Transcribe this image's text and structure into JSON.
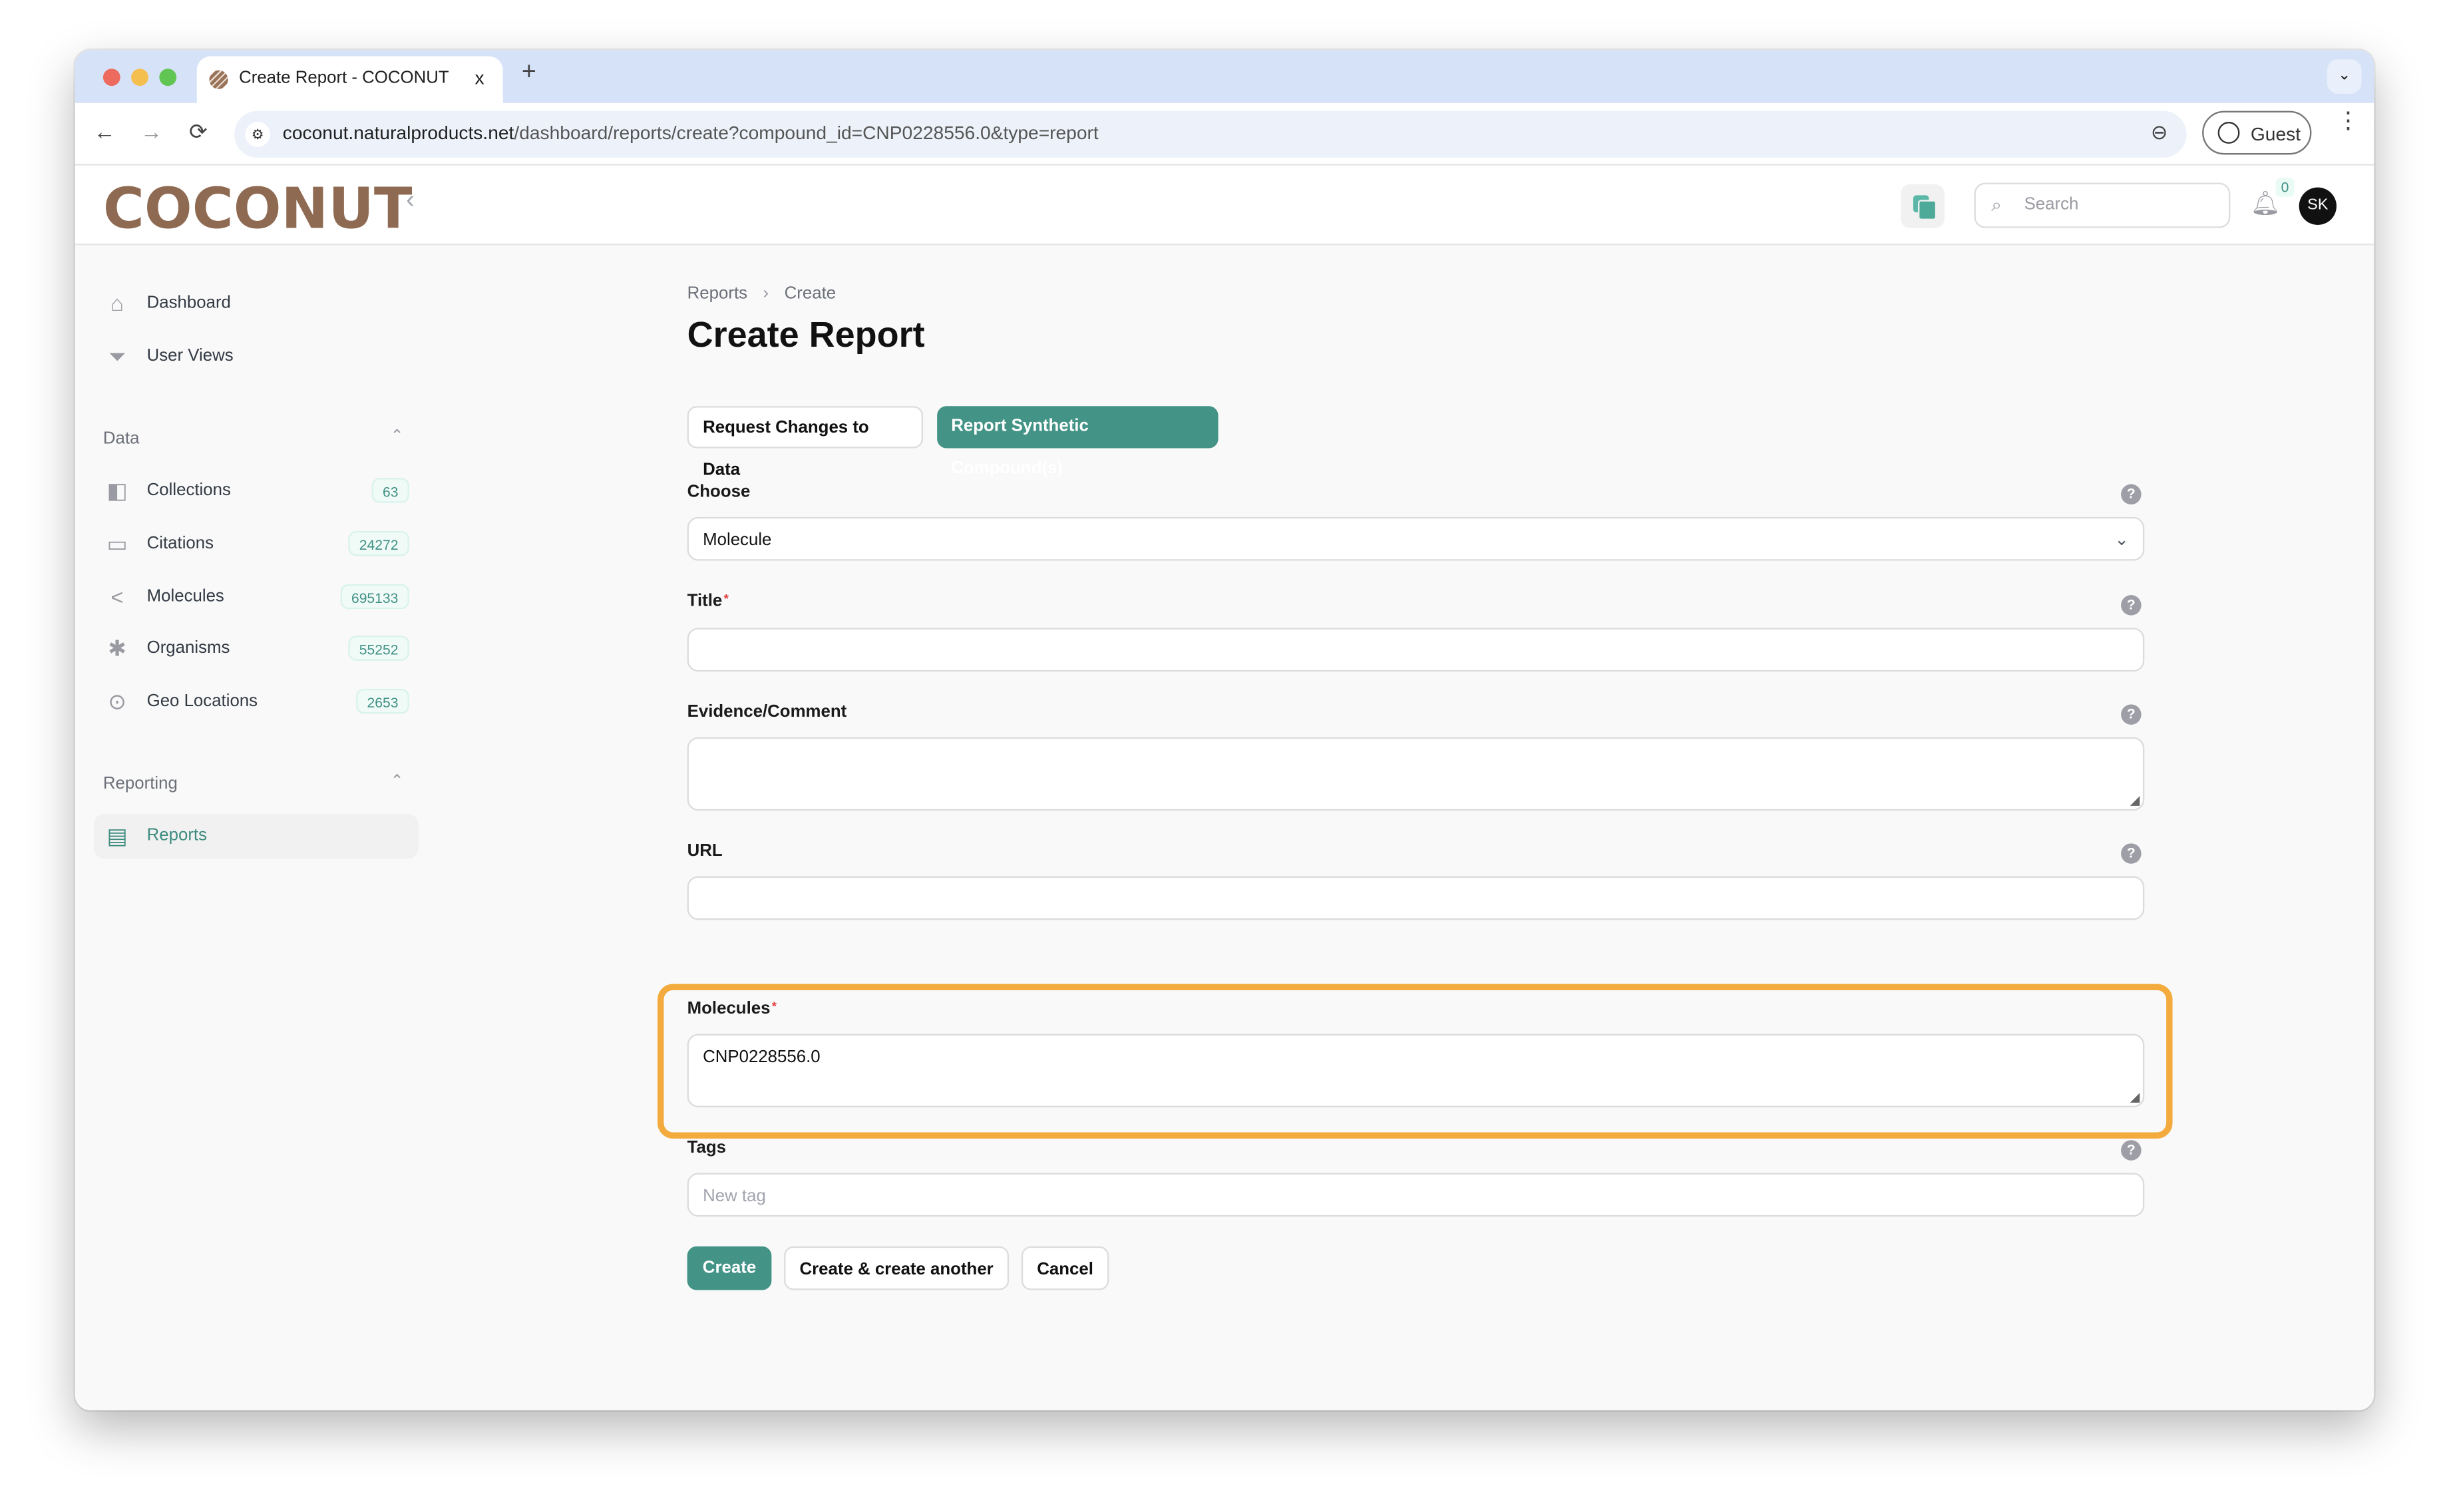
{
  "browser": {
    "tab_title": "Create Report - COCONUT",
    "tab_close": "x",
    "new_tab": "+",
    "tab_menu": "⌄",
    "url_host": "coconut.naturalproducts.net",
    "url_path": "/dashboard/reports/create?compound_id=CNP0228556.0&type=report",
    "profile_label": "Guest",
    "back": "←",
    "forward": "→",
    "reload": "⟳",
    "zoom_icon": "⊖",
    "menu": "⋮"
  },
  "app": {
    "logo": "COCONUT",
    "collapse": "‹",
    "search_placeholder": "Search",
    "notification_count": "0",
    "avatar_initials": "SK"
  },
  "sidebar": {
    "top_items": [
      {
        "label": "Dashboard",
        "icon": "home-icon"
      },
      {
        "label": "User Views",
        "icon": "filter-icon"
      }
    ],
    "groups": [
      {
        "label": "Data",
        "items": [
          {
            "label": "Collections",
            "count": "63",
            "icon": "swatch-icon"
          },
          {
            "label": "Citations",
            "count": "24272",
            "icon": "ticket-icon"
          },
          {
            "label": "Molecules",
            "count": "695133",
            "icon": "share-icon"
          },
          {
            "label": "Organisms",
            "count": "55252",
            "icon": "bug-icon"
          },
          {
            "label": "Geo Locations",
            "count": "2653",
            "icon": "map-pin-icon"
          }
        ]
      },
      {
        "label": "Reporting",
        "items": [
          {
            "label": "Reports",
            "icon": "archive-box-icon",
            "active": true
          }
        ]
      }
    ]
  },
  "main": {
    "breadcrumb": [
      "Reports",
      "Create"
    ],
    "title": "Create Report",
    "type_buttons": [
      "Request Changes to Data",
      "Report Synthetic Compound(s)"
    ],
    "fields": {
      "choose": {
        "label": "Choose",
        "value": "Molecule"
      },
      "title": {
        "label": "Title",
        "required": "*",
        "value": ""
      },
      "evidence": {
        "label": "Evidence/Comment",
        "value": ""
      },
      "url": {
        "label": "URL",
        "value": ""
      },
      "molecules": {
        "label": "Molecules",
        "required": "*",
        "value": "CNP0228556.0"
      },
      "tags": {
        "label": "Tags",
        "placeholder": "New tag"
      }
    },
    "help": "?",
    "actions": {
      "create": "Create",
      "create_another": "Create & create another",
      "cancel": "Cancel"
    }
  },
  "colors": {
    "accent": "#439386",
    "highlight": "#f2ab3c",
    "logo": "#8f6a52"
  }
}
